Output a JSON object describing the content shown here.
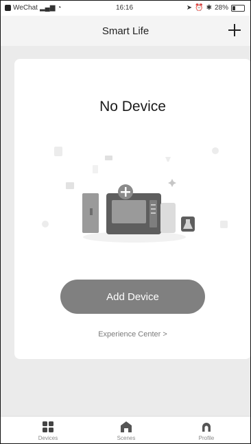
{
  "status_bar": {
    "carrier": "WeChat",
    "time": "16:16",
    "battery": "28%",
    "battery_level": 0.28
  },
  "nav": {
    "title": "Smart Life",
    "add_icon": "plus-icon"
  },
  "main": {
    "title": "No Device",
    "add_device_label": "Add Device",
    "experience_center_label": "Experience Center >"
  },
  "tabs": [
    {
      "label": "Devices",
      "icon": "devices-grid-icon",
      "active": true
    },
    {
      "label": "Scenes",
      "icon": "home-icon",
      "active": false
    },
    {
      "label": "Profile",
      "icon": "profile-icon",
      "active": false
    }
  ],
  "colors": {
    "primary_button": "#808080",
    "page_background": "#ebebeb",
    "card_background": "#ffffff"
  }
}
